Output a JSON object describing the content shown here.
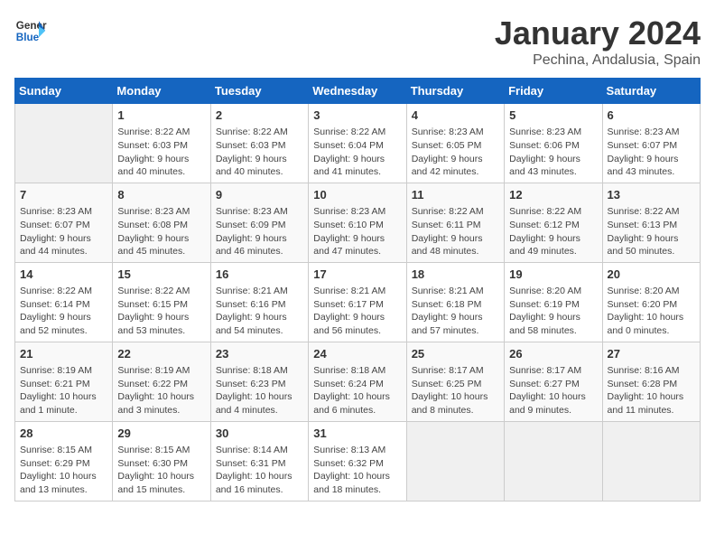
{
  "header": {
    "logo_line1": "General",
    "logo_line2": "Blue",
    "month": "January 2024",
    "location": "Pechina, Andalusia, Spain"
  },
  "days_of_week": [
    "Sunday",
    "Monday",
    "Tuesday",
    "Wednesday",
    "Thursday",
    "Friday",
    "Saturday"
  ],
  "weeks": [
    [
      {
        "day": "",
        "info": ""
      },
      {
        "day": "1",
        "info": "Sunrise: 8:22 AM\nSunset: 6:03 PM\nDaylight: 9 hours\nand 40 minutes."
      },
      {
        "day": "2",
        "info": "Sunrise: 8:22 AM\nSunset: 6:03 PM\nDaylight: 9 hours\nand 40 minutes."
      },
      {
        "day": "3",
        "info": "Sunrise: 8:22 AM\nSunset: 6:04 PM\nDaylight: 9 hours\nand 41 minutes."
      },
      {
        "day": "4",
        "info": "Sunrise: 8:23 AM\nSunset: 6:05 PM\nDaylight: 9 hours\nand 42 minutes."
      },
      {
        "day": "5",
        "info": "Sunrise: 8:23 AM\nSunset: 6:06 PM\nDaylight: 9 hours\nand 43 minutes."
      },
      {
        "day": "6",
        "info": "Sunrise: 8:23 AM\nSunset: 6:07 PM\nDaylight: 9 hours\nand 43 minutes."
      }
    ],
    [
      {
        "day": "7",
        "info": "Sunrise: 8:23 AM\nSunset: 6:07 PM\nDaylight: 9 hours\nand 44 minutes."
      },
      {
        "day": "8",
        "info": "Sunrise: 8:23 AM\nSunset: 6:08 PM\nDaylight: 9 hours\nand 45 minutes."
      },
      {
        "day": "9",
        "info": "Sunrise: 8:23 AM\nSunset: 6:09 PM\nDaylight: 9 hours\nand 46 minutes."
      },
      {
        "day": "10",
        "info": "Sunrise: 8:23 AM\nSunset: 6:10 PM\nDaylight: 9 hours\nand 47 minutes."
      },
      {
        "day": "11",
        "info": "Sunrise: 8:22 AM\nSunset: 6:11 PM\nDaylight: 9 hours\nand 48 minutes."
      },
      {
        "day": "12",
        "info": "Sunrise: 8:22 AM\nSunset: 6:12 PM\nDaylight: 9 hours\nand 49 minutes."
      },
      {
        "day": "13",
        "info": "Sunrise: 8:22 AM\nSunset: 6:13 PM\nDaylight: 9 hours\nand 50 minutes."
      }
    ],
    [
      {
        "day": "14",
        "info": "Sunrise: 8:22 AM\nSunset: 6:14 PM\nDaylight: 9 hours\nand 52 minutes."
      },
      {
        "day": "15",
        "info": "Sunrise: 8:22 AM\nSunset: 6:15 PM\nDaylight: 9 hours\nand 53 minutes."
      },
      {
        "day": "16",
        "info": "Sunrise: 8:21 AM\nSunset: 6:16 PM\nDaylight: 9 hours\nand 54 minutes."
      },
      {
        "day": "17",
        "info": "Sunrise: 8:21 AM\nSunset: 6:17 PM\nDaylight: 9 hours\nand 56 minutes."
      },
      {
        "day": "18",
        "info": "Sunrise: 8:21 AM\nSunset: 6:18 PM\nDaylight: 9 hours\nand 57 minutes."
      },
      {
        "day": "19",
        "info": "Sunrise: 8:20 AM\nSunset: 6:19 PM\nDaylight: 9 hours\nand 58 minutes."
      },
      {
        "day": "20",
        "info": "Sunrise: 8:20 AM\nSunset: 6:20 PM\nDaylight: 10 hours\nand 0 minutes."
      }
    ],
    [
      {
        "day": "21",
        "info": "Sunrise: 8:19 AM\nSunset: 6:21 PM\nDaylight: 10 hours\nand 1 minute."
      },
      {
        "day": "22",
        "info": "Sunrise: 8:19 AM\nSunset: 6:22 PM\nDaylight: 10 hours\nand 3 minutes."
      },
      {
        "day": "23",
        "info": "Sunrise: 8:18 AM\nSunset: 6:23 PM\nDaylight: 10 hours\nand 4 minutes."
      },
      {
        "day": "24",
        "info": "Sunrise: 8:18 AM\nSunset: 6:24 PM\nDaylight: 10 hours\nand 6 minutes."
      },
      {
        "day": "25",
        "info": "Sunrise: 8:17 AM\nSunset: 6:25 PM\nDaylight: 10 hours\nand 8 minutes."
      },
      {
        "day": "26",
        "info": "Sunrise: 8:17 AM\nSunset: 6:27 PM\nDaylight: 10 hours\nand 9 minutes."
      },
      {
        "day": "27",
        "info": "Sunrise: 8:16 AM\nSunset: 6:28 PM\nDaylight: 10 hours\nand 11 minutes."
      }
    ],
    [
      {
        "day": "28",
        "info": "Sunrise: 8:15 AM\nSunset: 6:29 PM\nDaylight: 10 hours\nand 13 minutes."
      },
      {
        "day": "29",
        "info": "Sunrise: 8:15 AM\nSunset: 6:30 PM\nDaylight: 10 hours\nand 15 minutes."
      },
      {
        "day": "30",
        "info": "Sunrise: 8:14 AM\nSunset: 6:31 PM\nDaylight: 10 hours\nand 16 minutes."
      },
      {
        "day": "31",
        "info": "Sunrise: 8:13 AM\nSunset: 6:32 PM\nDaylight: 10 hours\nand 18 minutes."
      },
      {
        "day": "",
        "info": ""
      },
      {
        "day": "",
        "info": ""
      },
      {
        "day": "",
        "info": ""
      }
    ]
  ]
}
